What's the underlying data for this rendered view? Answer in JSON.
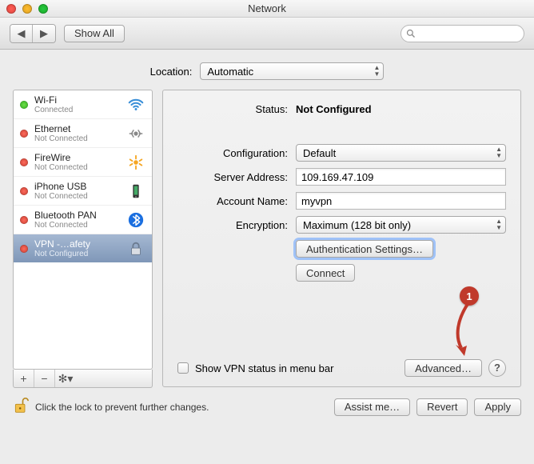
{
  "window": {
    "title": "Network"
  },
  "toolbar": {
    "show_all": "Show All",
    "search_placeholder": ""
  },
  "location": {
    "label": "Location:",
    "value": "Automatic"
  },
  "sidebar": {
    "items": [
      {
        "name": "Wi-Fi",
        "status": "Connected",
        "dot": "green",
        "icon": "wifi"
      },
      {
        "name": "Ethernet",
        "status": "Not Connected",
        "dot": "red",
        "icon": "ethernet"
      },
      {
        "name": "FireWire",
        "status": "Not Connected",
        "dot": "red",
        "icon": "firewire"
      },
      {
        "name": "iPhone USB",
        "status": "Not Connected",
        "dot": "red",
        "icon": "iphone"
      },
      {
        "name": "Bluetooth PAN",
        "status": "Not Connected",
        "dot": "red",
        "icon": "bluetooth"
      },
      {
        "name": "VPN -…afety",
        "status": "Not Configured",
        "dot": "red",
        "icon": "lock"
      }
    ],
    "buttons": {
      "add": "+",
      "remove": "−",
      "gear": "✻▾"
    }
  },
  "details": {
    "status_label": "Status:",
    "status_value": "Not Configured",
    "configuration_label": "Configuration:",
    "configuration_value": "Default",
    "server_label": "Server Address:",
    "server_value": "109.169.47.109",
    "account_label": "Account Name:",
    "account_value": "myvpn",
    "encryption_label": "Encryption:",
    "encryption_value": "Maximum (128 bit only)",
    "auth_button": "Authentication Settings…",
    "connect_button": "Connect",
    "show_status_label": "Show VPN status in menu bar",
    "advanced_button": "Advanced…",
    "help": "?"
  },
  "footer": {
    "lock_text": "Click the lock to prevent further changes.",
    "assist": "Assist me…",
    "revert": "Revert",
    "apply": "Apply"
  },
  "callout": {
    "num": "1"
  }
}
